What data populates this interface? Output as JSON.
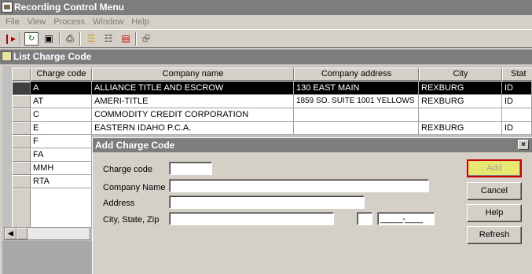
{
  "app": {
    "title": "Recording Control Menu",
    "icon": "app-icon"
  },
  "menu": [
    "File",
    "View",
    "Process",
    "Window",
    "Help"
  ],
  "toolbar_icons": [
    "exit-door-icon",
    "refresh-icon",
    "binoculars-icon",
    "print-icon",
    "list-icon",
    "folder-tree-icon",
    "cards-icon",
    "network-icon"
  ],
  "child": {
    "title": "List Charge Code"
  },
  "grid": {
    "columns": [
      "Charge code",
      "Company name",
      "Company address",
      "City",
      "Stat"
    ],
    "rows": [
      {
        "code": "A",
        "name": "ALLIANCE TITLE AND ESCROW",
        "address": "130 EAST MAIN",
        "city": "REXBURG",
        "state": "ID"
      },
      {
        "code": "AT",
        "name": "AMERI-TITLE",
        "address": "1859 SO.  SUITE 1001 YELLOWS",
        "city": "REXBURG",
        "state": "ID"
      },
      {
        "code": "C",
        "name": "COMMODITY CREDIT CORPORATION",
        "address": "",
        "city": "",
        "state": ""
      },
      {
        "code": "E",
        "name": "EASTERN IDAHO P.C.A.",
        "address": "",
        "city": "REXBURG",
        "state": "ID"
      },
      {
        "code": "F",
        "name": "",
        "address": "",
        "city": "",
        "state": ""
      },
      {
        "code": "FA",
        "name": "",
        "address": "",
        "city": "",
        "state": ""
      },
      {
        "code": "MMH",
        "name": "",
        "address": "",
        "city": "",
        "state": ""
      },
      {
        "code": "RTA",
        "name": "",
        "address": "",
        "city": "",
        "state": ""
      }
    ]
  },
  "dialog": {
    "title": "Add Charge Code",
    "close": "×",
    "labels": {
      "charge_code": "Charge code",
      "company_name": "Company Name",
      "address": "Address",
      "city_state_zip": "City, State, Zip"
    },
    "values": {
      "charge_code": "",
      "company_name": "",
      "address": "",
      "city": "",
      "state": "",
      "zip": "_____-____"
    },
    "buttons": {
      "add": "Add",
      "cancel": "Cancel",
      "help": "Help",
      "refresh": "Refresh"
    }
  },
  "colors": {
    "titlebar": "#7d7d7d",
    "face": "#d4d0c8",
    "selected_row": "#000000",
    "highlight_border": "#cc0000",
    "highlight_fill": "#e8e870"
  }
}
